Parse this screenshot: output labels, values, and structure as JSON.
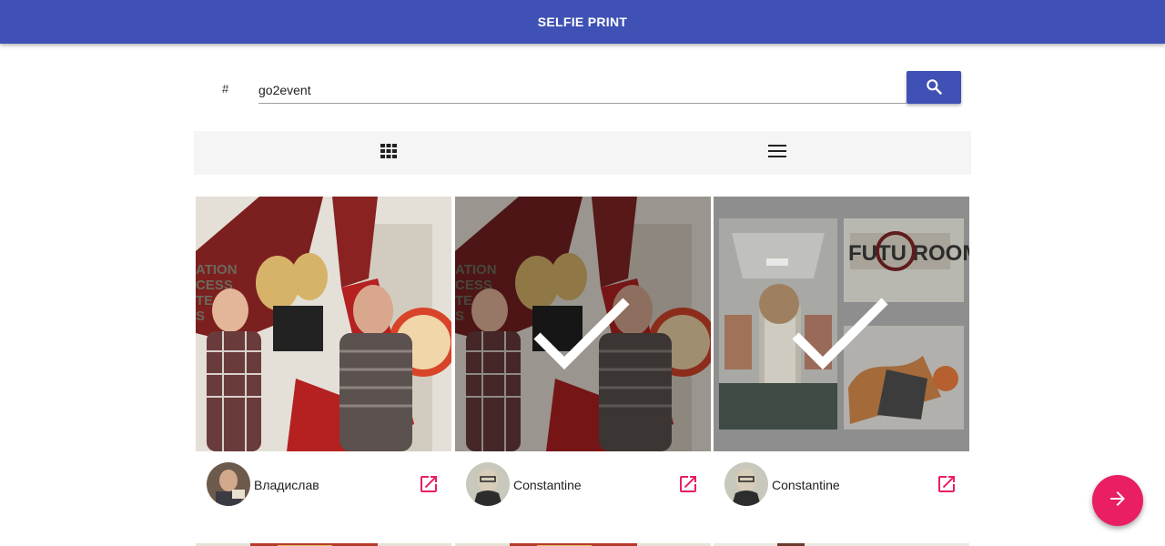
{
  "app": {
    "title": "SELFIE PRINT"
  },
  "search": {
    "prefix": "#",
    "value": "go2event",
    "button_icon": "search-icon"
  },
  "view_toggle": {
    "grid_icon": "grid-view-icon",
    "list_icon": "list-view-icon"
  },
  "photos": [
    {
      "author": "Владислав",
      "selected": false,
      "link_icon": "open-in-new-icon"
    },
    {
      "author": "Constantine",
      "selected": true,
      "link_icon": "open-in-new-icon"
    },
    {
      "author": "Constantine",
      "selected": true,
      "link_icon": "open-in-new-icon"
    }
  ],
  "fab": {
    "icon": "arrow-forward-icon"
  },
  "colors": {
    "primary": "#3f51b5",
    "accent": "#e91e63",
    "toolbar_bg": "#f5f5f5"
  }
}
